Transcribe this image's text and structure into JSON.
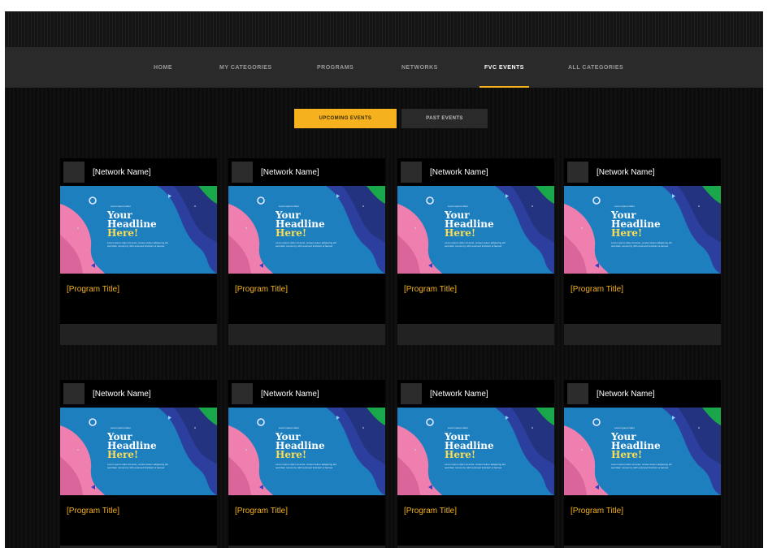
{
  "nav": {
    "items": [
      {
        "label": "HOME",
        "active": false
      },
      {
        "label": "MY CATEGORIES",
        "active": false
      },
      {
        "label": "PROGRAMS",
        "active": false
      },
      {
        "label": "NETWORKS",
        "active": false
      },
      {
        "label": "FVC EVENTS",
        "active": true
      },
      {
        "label": "ALL CATEGORIES",
        "active": false
      }
    ]
  },
  "tabs": {
    "upcoming": "UPCOMING EVENTS",
    "past": "PAST EVENTS"
  },
  "colors": {
    "accent": "#f5b21e",
    "background": "#0c0c0c",
    "navbar": "#2a2a2a",
    "thumb_blue": "#1e7fbf",
    "thumb_pink": "#ef7fae",
    "thumb_green": "#1aa64a"
  },
  "thumbnail": {
    "tag": "Lorem ipsum dolor",
    "line1": "Your",
    "line2": "Headline",
    "line3": "Here!",
    "body": "Lorem ipsum dolor sit amet, consec tetuer adipiscing elit sed diam nonummy nibh euismod tincidunt ut laoreet"
  },
  "events": [
    {
      "network": "[Network Name]",
      "program": "[Program Title]"
    },
    {
      "network": "[Network Name]",
      "program": "[Program Title]"
    },
    {
      "network": "[Network Name]",
      "program": "[Program Title]"
    },
    {
      "network": "[Network Name]",
      "program": "[Program Title]"
    },
    {
      "network": "[Network Name]",
      "program": "[Program Title]"
    },
    {
      "network": "[Network Name]",
      "program": "[Program Title]"
    },
    {
      "network": "[Network Name]",
      "program": "[Program Title]"
    },
    {
      "network": "[Network Name]",
      "program": "[Program Title]"
    }
  ]
}
